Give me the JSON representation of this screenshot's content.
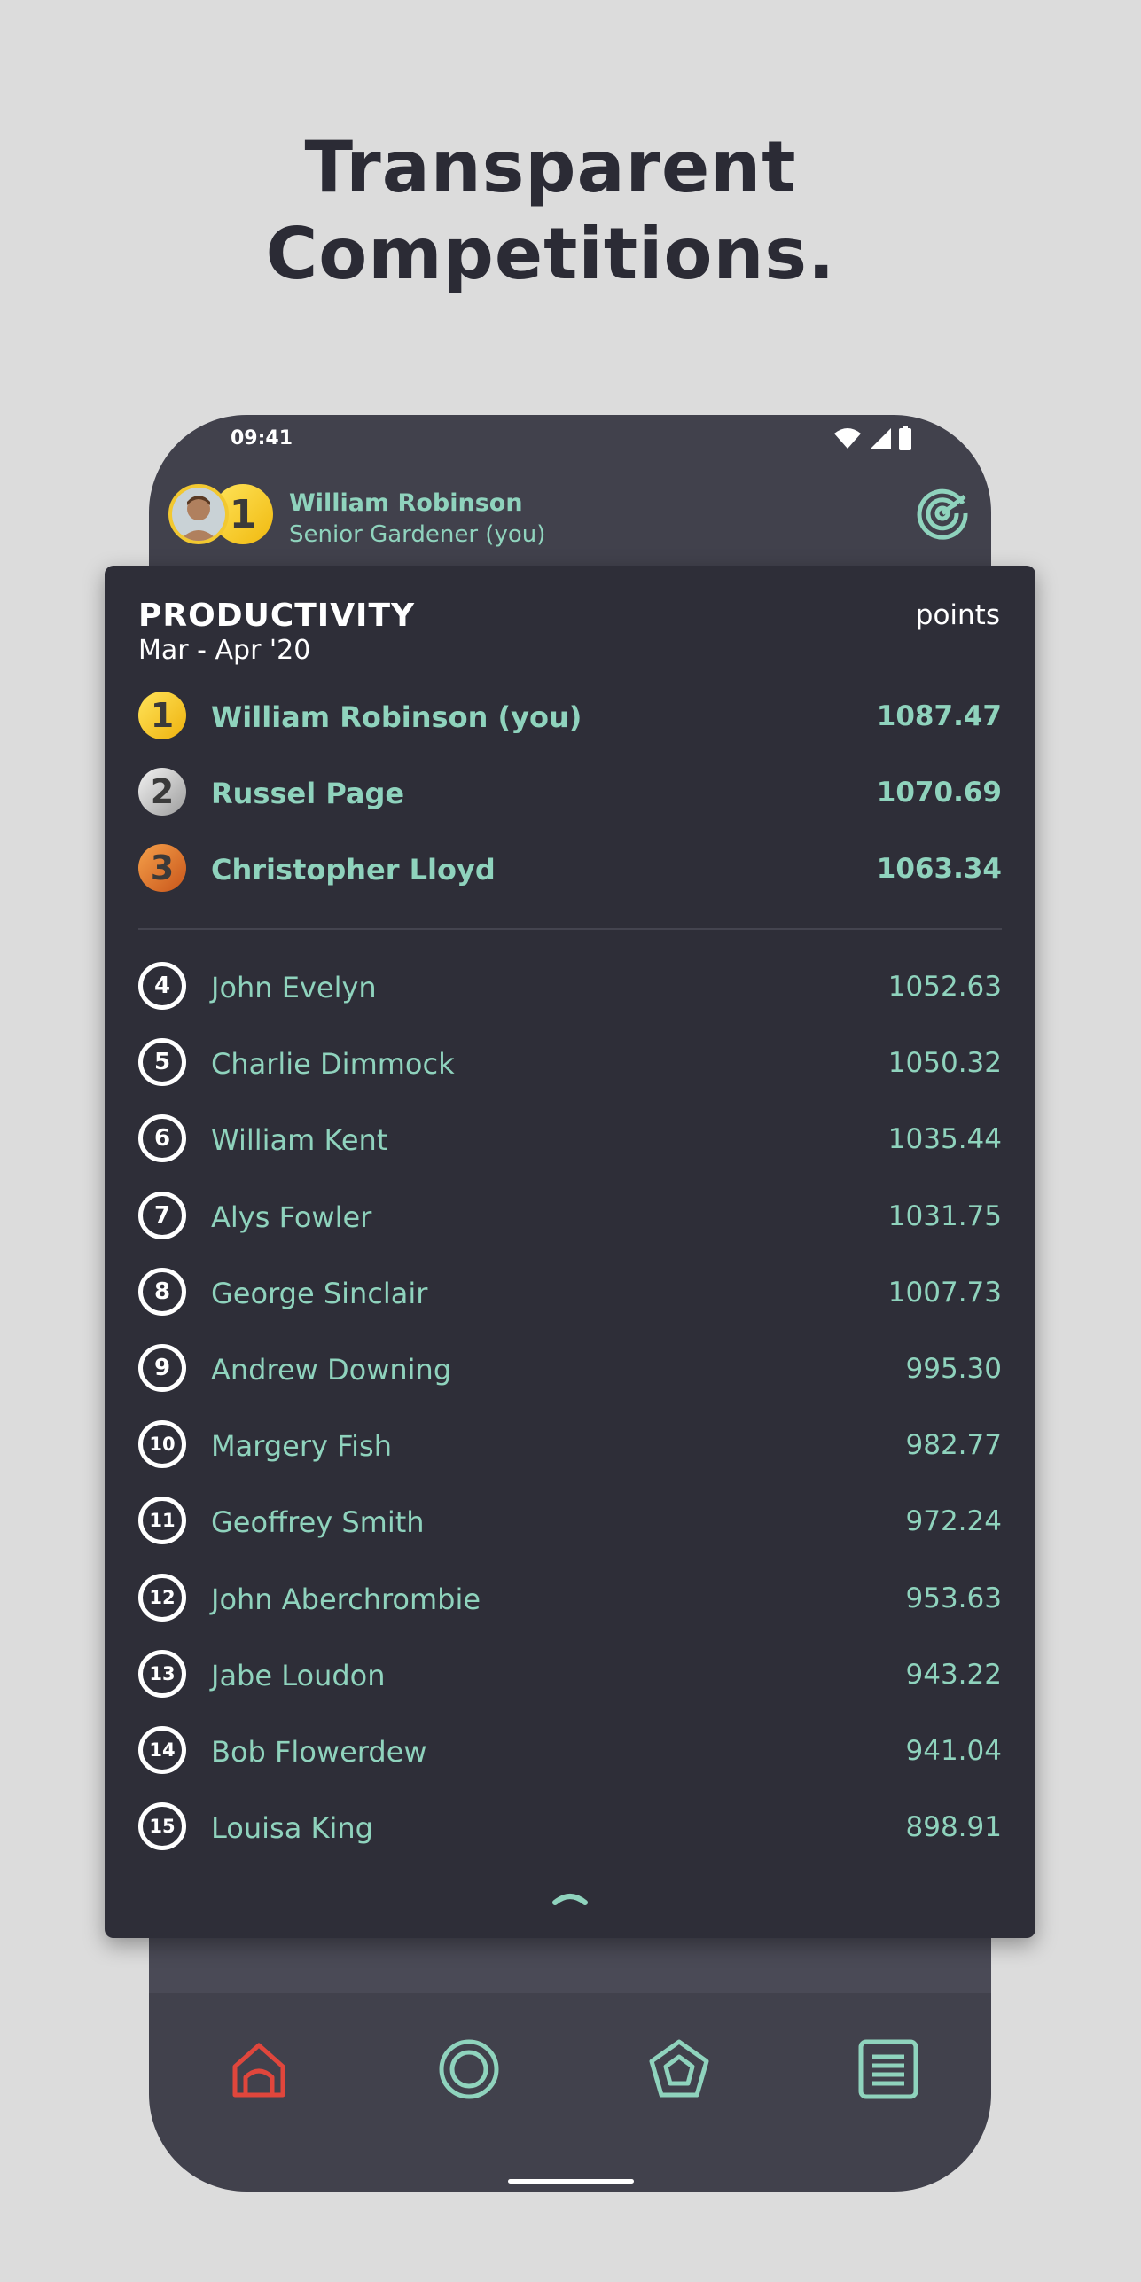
{
  "headline": {
    "line1": "Transparent",
    "line2": "Competitions."
  },
  "status_bar": {
    "time": "09:41"
  },
  "profile": {
    "name": "William Robinson",
    "role": "Senior Gardener (you)",
    "rank": "1"
  },
  "leaderboard": {
    "title": "PRODUCTIVITY",
    "period": "Mar - Apr '20",
    "unit": "points",
    "top": [
      {
        "rank": "1",
        "name": "William Robinson (you)",
        "points": "1087.47",
        "medal": "gold"
      },
      {
        "rank": "2",
        "name": "Russel Page",
        "points": "1070.69",
        "medal": "silver"
      },
      {
        "rank": "3",
        "name": "Christopher Lloyd",
        "points": "1063.34",
        "medal": "bronze"
      }
    ],
    "rest": [
      {
        "rank": "4",
        "name": "John Evelyn",
        "points": "1052.63"
      },
      {
        "rank": "5",
        "name": "Charlie Dimmock",
        "points": "1050.32"
      },
      {
        "rank": "6",
        "name": "William Kent",
        "points": "1035.44"
      },
      {
        "rank": "7",
        "name": "Alys Fowler",
        "points": "1031.75"
      },
      {
        "rank": "8",
        "name": "George Sinclair",
        "points": "1007.73"
      },
      {
        "rank": "9",
        "name": "Andrew Downing",
        "points": "995.30"
      },
      {
        "rank": "10",
        "name": "Margery Fish",
        "points": "982.77"
      },
      {
        "rank": "11",
        "name": "Geoffrey Smith",
        "points": "972.24"
      },
      {
        "rank": "12",
        "name": "John Aberchrombie",
        "points": "953.63"
      },
      {
        "rank": "13",
        "name": "Jabe Loudon",
        "points": "943.22"
      },
      {
        "rank": "14",
        "name": "Bob Flowerdew",
        "points": "941.04"
      },
      {
        "rank": "15",
        "name": "Louisa King",
        "points": "898.91"
      }
    ]
  },
  "bottom_nav": {
    "items": [
      {
        "icon": "home-icon",
        "active": true
      },
      {
        "icon": "circle-icon",
        "active": false
      },
      {
        "icon": "pentagon-icon",
        "active": false
      },
      {
        "icon": "list-icon",
        "active": false
      }
    ]
  },
  "colors": {
    "accent": "#8fd3bd",
    "active_nav": "#e0463c",
    "card_bg": "#2e2e38",
    "phone_bg": "#41414c",
    "page_bg": "#dcdcdc"
  }
}
